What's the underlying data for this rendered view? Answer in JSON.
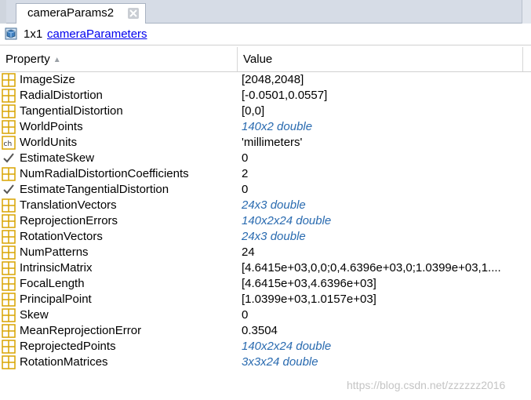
{
  "tab": {
    "label": "cameraParams2"
  },
  "info": {
    "size": "1x1",
    "class_link": "cameraParameters"
  },
  "columns": {
    "property": "Property",
    "value": "Value"
  },
  "rows": [
    {
      "name": "ImageSize",
      "value": "[2048,2048]",
      "icon": "grid-icon",
      "link": false
    },
    {
      "name": "RadialDistortion",
      "value": "[-0.0501,0.0557]",
      "icon": "grid-icon",
      "link": false
    },
    {
      "name": "TangentialDistortion",
      "value": "[0,0]",
      "icon": "grid-icon",
      "link": false
    },
    {
      "name": "WorldPoints",
      "value": "140x2 double",
      "icon": "grid-icon",
      "link": true
    },
    {
      "name": "WorldUnits",
      "value": "'millimeters'",
      "icon": "char-icon",
      "link": false
    },
    {
      "name": "EstimateSkew",
      "value": "0",
      "icon": "check-icon",
      "link": false
    },
    {
      "name": "NumRadialDistortionCoefficients",
      "value": "2",
      "icon": "grid-icon",
      "link": false
    },
    {
      "name": "EstimateTangentialDistortion",
      "value": "0",
      "icon": "check-icon",
      "link": false
    },
    {
      "name": "TranslationVectors",
      "value": "24x3 double",
      "icon": "grid-icon",
      "link": true
    },
    {
      "name": "ReprojectionErrors",
      "value": "140x2x24 double",
      "icon": "grid-icon",
      "link": true
    },
    {
      "name": "RotationVectors",
      "value": "24x3 double",
      "icon": "grid-icon",
      "link": true
    },
    {
      "name": "NumPatterns",
      "value": "24",
      "icon": "grid-icon",
      "link": false
    },
    {
      "name": "IntrinsicMatrix",
      "value": "[4.6415e+03,0,0;0,4.6396e+03,0;1.0399e+03,1....",
      "icon": "grid-icon",
      "link": false
    },
    {
      "name": "FocalLength",
      "value": "[4.6415e+03,4.6396e+03]",
      "icon": "grid-icon",
      "link": false
    },
    {
      "name": "PrincipalPoint",
      "value": "[1.0399e+03,1.0157e+03]",
      "icon": "grid-icon",
      "link": false
    },
    {
      "name": "Skew",
      "value": "0",
      "icon": "grid-icon",
      "link": false
    },
    {
      "name": "MeanReprojectionError",
      "value": "0.3504",
      "icon": "grid-icon",
      "link": false
    },
    {
      "name": "ReprojectedPoints",
      "value": "140x2x24 double",
      "icon": "grid-icon",
      "link": true
    },
    {
      "name": "RotationMatrices",
      "value": "3x3x24 double",
      "icon": "grid-icon",
      "link": true
    }
  ],
  "watermark": "https://blog.csdn.net/zzzzzz2016",
  "colors": {
    "link_value": "#2a6bb0",
    "class_link": "#0000ee",
    "icon_gold": "#d9a400"
  }
}
